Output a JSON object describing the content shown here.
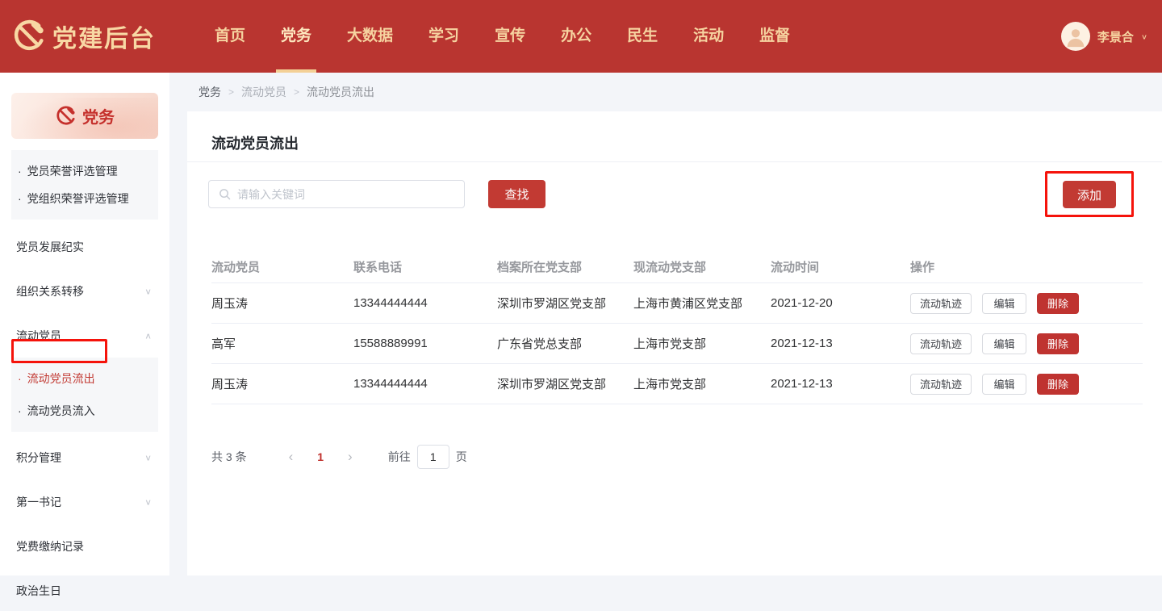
{
  "colors": {
    "topbar_red": "#b93530",
    "button_red": "#c23a33",
    "annotation_red": "#f5130b",
    "cream": "#f8d8a4",
    "active_text_red": "#c5302c"
  },
  "icons": {
    "chevron_down": "∨",
    "chevron_up": "∧",
    "user_chevron": "∨",
    "prev_arrow": "‹",
    "next_arrow": "›",
    "emblem": "party-emblem",
    "search": "magnifier"
  },
  "topbar": {
    "logo_text": "党建后台",
    "nav": {
      "items": [
        {
          "label": "首页"
        },
        {
          "label": "党务",
          "active": true
        },
        {
          "label": "大数据"
        },
        {
          "label": "学习"
        },
        {
          "label": "宣传"
        },
        {
          "label": "办公"
        },
        {
          "label": "民生"
        },
        {
          "label": "活动"
        },
        {
          "label": "监督"
        }
      ]
    },
    "user": {
      "name": "李景合"
    }
  },
  "sidebar": {
    "bullet": "·",
    "banner": {
      "label": "党务"
    },
    "honor_group": {
      "items": [
        {
          "label": "党员荣誉评选管理"
        },
        {
          "label": "党组织荣誉评选管理"
        }
      ]
    },
    "items": [
      {
        "label": "党员发展纪实"
      },
      {
        "label": "组织关系转移"
      },
      {
        "label": "流动党员"
      },
      {
        "label": "积分管理"
      },
      {
        "label": "第一书记"
      },
      {
        "label": "党费缴纳记录"
      },
      {
        "label": "政治生日"
      }
    ],
    "mobile_group": {
      "items": [
        {
          "label": "流动党员流出",
          "active": true
        },
        {
          "label": "流动党员流入"
        }
      ]
    }
  },
  "breadcrumb": {
    "items": [
      "党务",
      "流动党员",
      "流动党员流出"
    ],
    "separator": ">"
  },
  "page": {
    "title": "流动党员流出"
  },
  "search": {
    "placeholder": "请输入关键词",
    "find_label": "查找",
    "add_label": "添加"
  },
  "table": {
    "columns": [
      "流动党员",
      "联系电话",
      "档案所在党支部",
      "现流动党支部",
      "流动时间",
      "操作"
    ],
    "rows": [
      {
        "member": "周玉涛",
        "phone": "13344444444",
        "archive_branch": "深圳市罗湖区党支部",
        "current_branch": "上海市黄浦区党支部",
        "flow_date": "2021-12-20"
      },
      {
        "member": "高军",
        "phone": "15588889991",
        "archive_branch": "广东省党总支部",
        "current_branch": "上海市党支部",
        "flow_date": "2021-12-13"
      },
      {
        "member": "周玉涛",
        "phone": "13344444444",
        "archive_branch": "深圳市罗湖区党支部",
        "current_branch": "上海市党支部",
        "flow_date": "2021-12-13"
      }
    ],
    "actions": {
      "track": "流动轨迹",
      "edit": "编辑",
      "delete": "删除"
    }
  },
  "pagination": {
    "total": "共 3 条",
    "page": "1",
    "goto_label": "前往",
    "goto_value": "1",
    "unit": "页"
  }
}
